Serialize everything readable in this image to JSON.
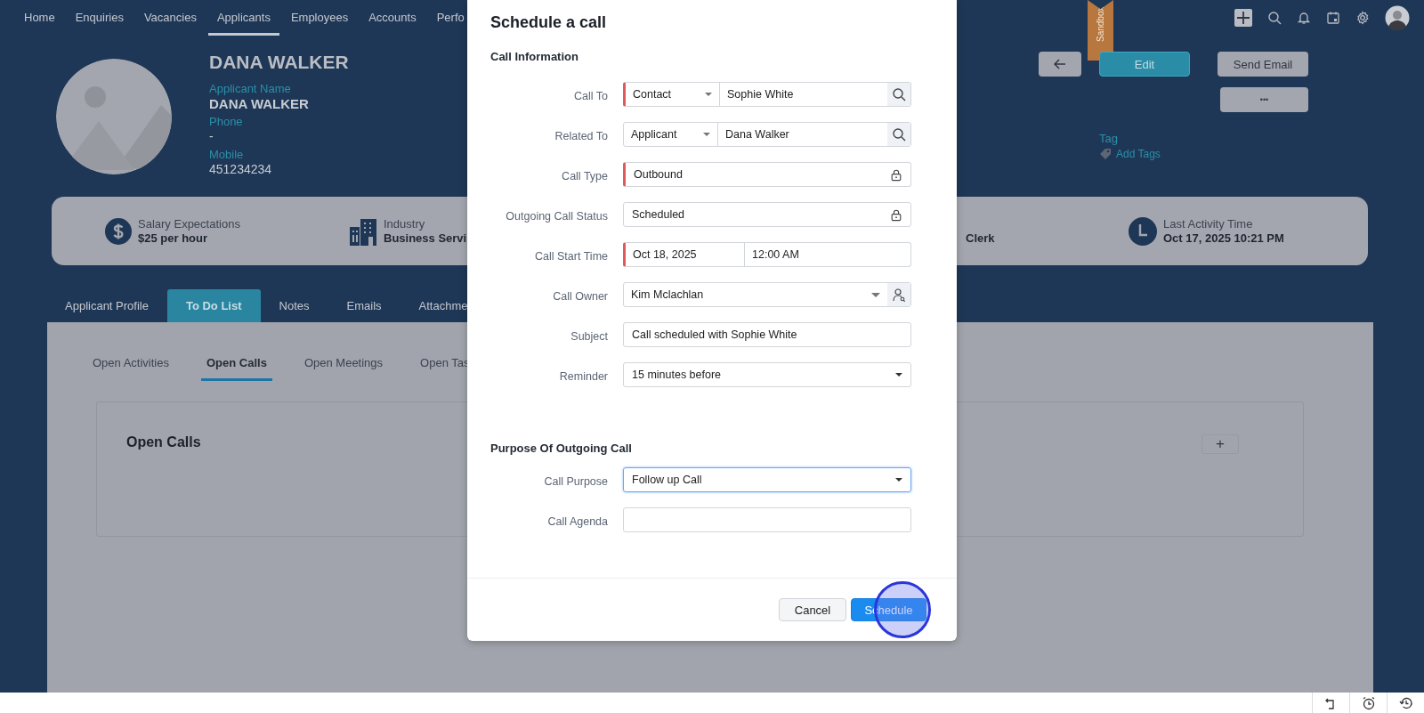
{
  "top_nav": {
    "items": [
      {
        "label": "Home",
        "selected": false
      },
      {
        "label": "Enquiries",
        "selected": false
      },
      {
        "label": "Vacancies",
        "selected": false
      },
      {
        "label": "Applicants",
        "selected": true
      },
      {
        "label": "Employees",
        "selected": false
      },
      {
        "label": "Accounts",
        "selected": false
      },
      {
        "label": "Perfo",
        "selected": false
      }
    ]
  },
  "sandbox_badge": "Sandbox",
  "profile": {
    "title": "DANA WALKER",
    "fields": [
      {
        "label": "Applicant Name",
        "value": "DANA WALKER"
      },
      {
        "label": "Phone",
        "value": "-"
      },
      {
        "label": "Mobile",
        "value": "451234234"
      }
    ]
  },
  "actions": {
    "edit": "Edit",
    "send_email": "Send Email",
    "more": "•••"
  },
  "tag": {
    "label": "Tag",
    "link": "Add Tags"
  },
  "summary": [
    {
      "kind": "dollar",
      "label": "Salary Expectations",
      "value": "$25 per hour"
    },
    {
      "kind": "building",
      "label": "Industry",
      "value": "Business Servi"
    },
    {
      "kind": "plain",
      "value": "Clerk"
    },
    {
      "kind": "clock",
      "label": "Last Activity Time",
      "value": "Oct 17, 2025 10:21 PM"
    }
  ],
  "record_tabs": [
    {
      "label": "Applicant Profile",
      "selected": false
    },
    {
      "label": "To Do List",
      "selected": true
    },
    {
      "label": "Notes",
      "selected": false
    },
    {
      "label": "Emails",
      "selected": false
    },
    {
      "label": "Attachme",
      "selected": false
    }
  ],
  "sub_tabs": [
    {
      "label": "Open Activities",
      "selected": false
    },
    {
      "label": "Open Calls",
      "selected": true
    },
    {
      "label": "Open Meetings",
      "selected": false
    },
    {
      "label": "Open Tas",
      "selected": false
    }
  ],
  "open_calls": {
    "title": "Open Calls",
    "add": "+"
  },
  "dialog": {
    "title": "Schedule a call",
    "sections": [
      {
        "heading": "Call Information",
        "fields": [
          {
            "label": "Call To",
            "kind": "lookup",
            "required": true,
            "focused": false,
            "module": "Contact",
            "value": "Sophie White"
          },
          {
            "label": "Related To",
            "kind": "lookup",
            "required": false,
            "focused": false,
            "module": "Applicant",
            "value": "Dana Walker"
          },
          {
            "label": "Call Type",
            "kind": "locked",
            "required": true,
            "focused": false,
            "value": "Outbound"
          },
          {
            "label": "Outgoing Call Status",
            "kind": "locked",
            "required": false,
            "focused": false,
            "value": "Scheduled"
          },
          {
            "label": "Call Start Time",
            "kind": "datetime",
            "required": true,
            "focused": false,
            "date": "Oct 18, 2025",
            "time": "12:00 AM"
          },
          {
            "label": "Call Owner",
            "kind": "user",
            "required": false,
            "focused": false,
            "value": "Kim Mclachlan"
          },
          {
            "label": "Subject",
            "kind": "text",
            "required": false,
            "focused": false,
            "value": "Call scheduled with Sophie White"
          },
          {
            "label": "Reminder",
            "kind": "select",
            "required": false,
            "focused": false,
            "value": "15 minutes before"
          }
        ]
      },
      {
        "heading": "Purpose Of Outgoing Call",
        "fields": [
          {
            "label": "Call Purpose",
            "kind": "select",
            "required": false,
            "focused": true,
            "value": "Follow up Call"
          },
          {
            "label": "Call Agenda",
            "kind": "text",
            "required": false,
            "focused": false
          }
        ]
      }
    ],
    "buttons": [
      {
        "label": "Cancel",
        "kind": "secondary",
        "highlighted": false
      },
      {
        "label": "Schedule",
        "kind": "primary",
        "highlighted": true
      }
    ]
  }
}
